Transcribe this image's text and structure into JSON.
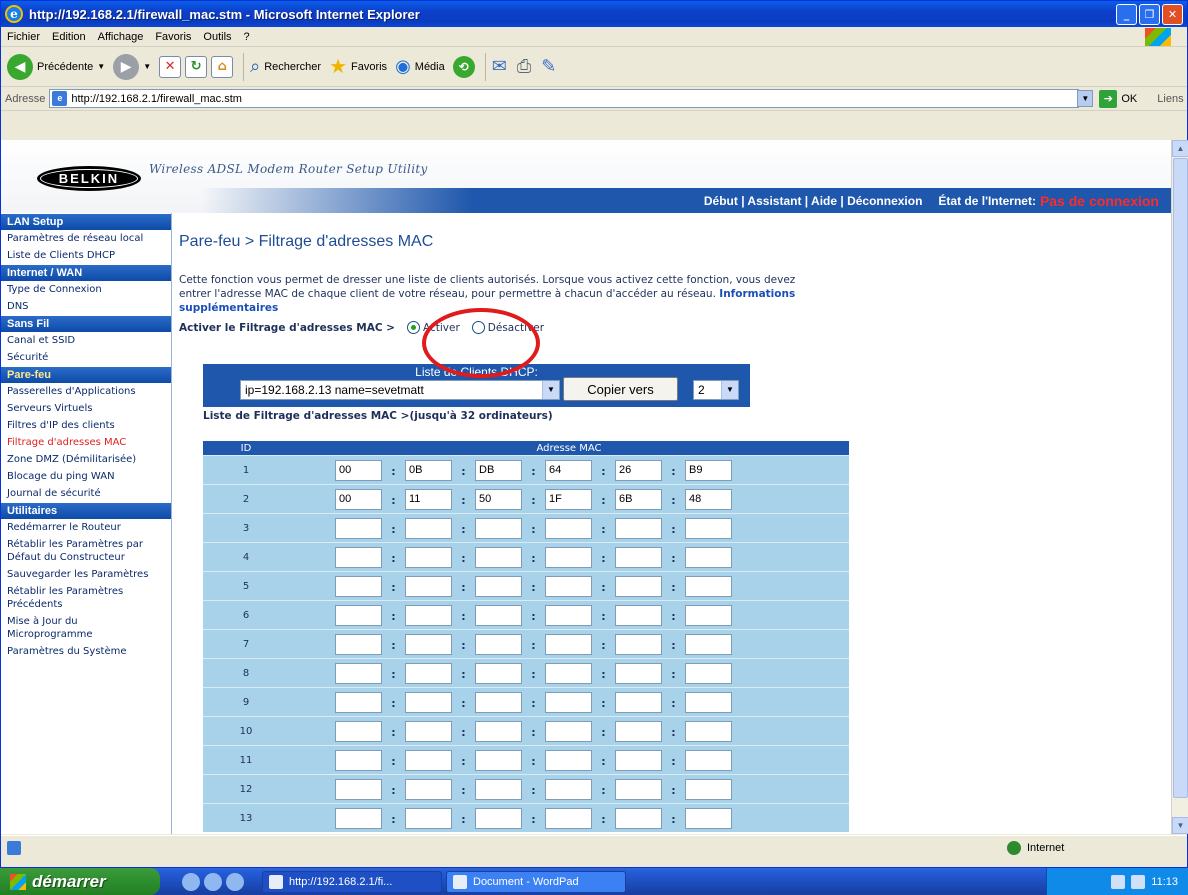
{
  "window": {
    "title": "http://192.168.2.1/firewall_mac.stm - Microsoft Internet Explorer"
  },
  "menu": [
    "Fichier",
    "Edition",
    "Affichage",
    "Favoris",
    "Outils",
    "?"
  ],
  "toolbar": {
    "back": "Précédente",
    "search": "Rechercher",
    "favorites": "Favoris",
    "media": "Média"
  },
  "address": {
    "label": "Adresse",
    "url": "http://192.168.2.1/firewall_mac.stm",
    "go": "OK",
    "links": "Liens"
  },
  "header": {
    "logo": "BELKIN",
    "utility": "Wireless ADSL Modem Router Setup Utility",
    "nav": "Début | Assistant | Aide | Déconnexion",
    "status_label": "État de l'Internet:",
    "status_value": "Pas de connexion"
  },
  "sidebar": {
    "lan": "LAN Setup",
    "lan_items": [
      "Paramètres de réseau local",
      "Liste de Clients DHCP"
    ],
    "wan": "Internet / WAN",
    "wan_items": [
      "Type de Connexion",
      "DNS"
    ],
    "wifi": "Sans Fil",
    "wifi_items": [
      "Canal et SSID",
      "Sécurité"
    ],
    "fw": "Pare-feu",
    "fw_items": [
      "Passerelles d'Applications",
      "Serveurs Virtuels",
      "Filtres d'IP des clients",
      "Filtrage d'adresses MAC",
      "Zone DMZ (Démilitarisée)",
      "Blocage du ping WAN",
      "Journal de sécurité"
    ],
    "util": "Utilitaires",
    "util_items": [
      "Redémarrer le Routeur",
      "Rétablir les Paramètres par Défaut du Constructeur",
      "Sauvegarder les Paramètres",
      "Rétablir les Paramètres Précédents",
      "Mise à Jour du Microprogramme",
      "Paramètres du Système"
    ]
  },
  "main": {
    "title": "Pare-feu > Filtrage d'adresses MAC",
    "description": "Cette fonction vous permet de dresser une liste de clients autorisés. Lorsque vous activez cette fonction, vous devez entrer l'adresse MAC de chaque client de votre réseau, pour permettre à chacun d'accéder au réseau.",
    "more_info": "Informations supplémentaires",
    "enable_label": "Activer le Filtrage d'adresses MAC >",
    "enable_on": "Activer",
    "enable_off": "Désactiver",
    "dhcp_caption": "Liste de Clients DHCP:",
    "dhcp_selected": "ip=192.168.2.13 name=sevetmatt",
    "copy_button": "Copier vers",
    "copy_target": "2",
    "list_label": "Liste de Filtrage d'adresses MAC >(jusqu'à 32 ordinateurs)",
    "col_id": "ID",
    "col_mac": "Adresse MAC",
    "rows": [
      {
        "id": "1",
        "mac": [
          "00",
          "0B",
          "DB",
          "64",
          "26",
          "B9"
        ]
      },
      {
        "id": "2",
        "mac": [
          "00",
          "11",
          "50",
          "1F",
          "6B",
          "48"
        ]
      },
      {
        "id": "3",
        "mac": [
          "",
          "",
          "",
          "",
          "",
          ""
        ]
      },
      {
        "id": "4",
        "mac": [
          "",
          "",
          "",
          "",
          "",
          ""
        ]
      },
      {
        "id": "5",
        "mac": [
          "",
          "",
          "",
          "",
          "",
          ""
        ]
      },
      {
        "id": "6",
        "mac": [
          "",
          "",
          "",
          "",
          "",
          ""
        ]
      },
      {
        "id": "7",
        "mac": [
          "",
          "",
          "",
          "",
          "",
          ""
        ]
      },
      {
        "id": "8",
        "mac": [
          "",
          "",
          "",
          "",
          "",
          ""
        ]
      },
      {
        "id": "9",
        "mac": [
          "",
          "",
          "",
          "",
          "",
          ""
        ]
      },
      {
        "id": "10",
        "mac": [
          "",
          "",
          "",
          "",
          "",
          ""
        ]
      },
      {
        "id": "11",
        "mac": [
          "",
          "",
          "",
          "",
          "",
          ""
        ]
      },
      {
        "id": "12",
        "mac": [
          "",
          "",
          "",
          "",
          "",
          ""
        ]
      },
      {
        "id": "13",
        "mac": [
          "",
          "",
          "",
          "",
          "",
          ""
        ]
      }
    ]
  },
  "statusbar": {
    "zone": "Internet"
  },
  "taskbar": {
    "start": "démarrer",
    "tasks": [
      "http://192.168.2.1/fi...",
      "Document - WordPad"
    ],
    "clock": "11:13"
  },
  "colors": {
    "nav_blue": "#1e57ac",
    "status_red": "#ff2a2a",
    "table_cell": "#a8d2ea",
    "annotation_red": "#e01b1b"
  }
}
